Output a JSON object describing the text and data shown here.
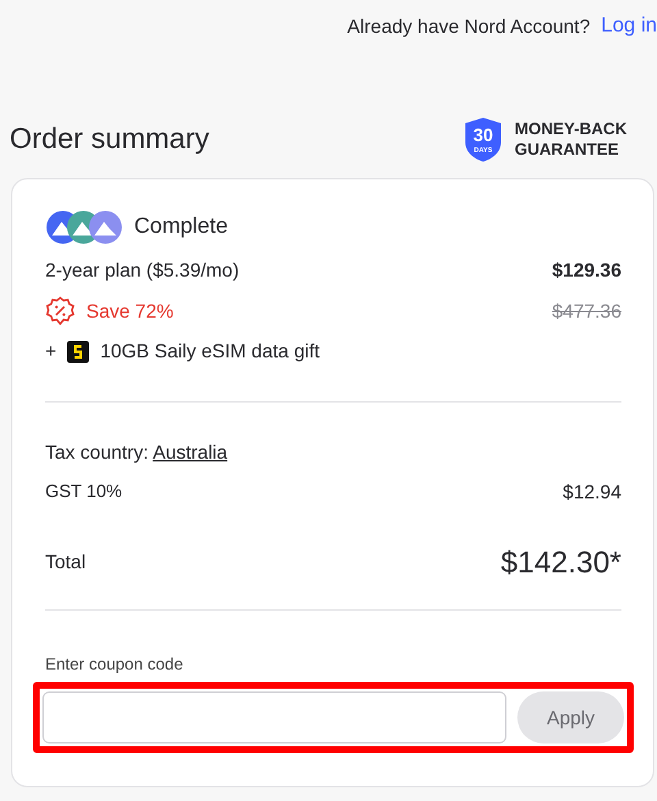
{
  "header": {
    "question": "Already have Nord Account?",
    "login_link": "Log in"
  },
  "title": "Order summary",
  "guarantee": {
    "days": "30",
    "unit": "DAYS",
    "line_1": "MONEY-BACK",
    "line_2": "GUARANTEE"
  },
  "plan": {
    "name": "Complete",
    "term": "2-year plan ($5.39/mo)",
    "price": "$129.36",
    "saving": "Save 72%",
    "old_price": "$477.36",
    "gift_plus": "+",
    "gift": "10GB Saily eSIM data gift"
  },
  "tax": {
    "label": "Tax country:",
    "country": "Australia",
    "gst_label": "GST 10%",
    "gst_amount": "$12.94"
  },
  "total": {
    "label": "Total",
    "amount": "$142.30*"
  },
  "coupon": {
    "label": "Enter coupon code",
    "button": "Apply",
    "highlighted": true
  }
}
